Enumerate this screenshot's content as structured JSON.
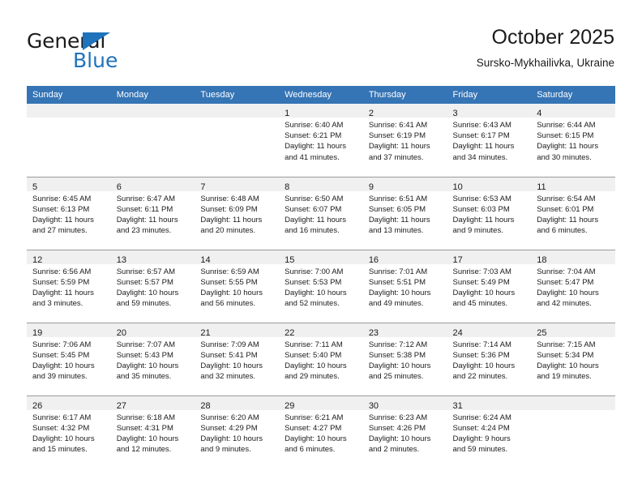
{
  "brand": {
    "name_top": "General",
    "name_bottom": "Blue",
    "accent_color": "#1f72bc",
    "triangle_icon": "triangle-icon"
  },
  "header": {
    "title": "October 2025",
    "subtitle": "Sursko-Mykhailivka, Ukraine"
  },
  "theme": {
    "header_row_bg": "#3574b5",
    "daynum_band_bg": "#f0f0f0",
    "grid_line": "#9a9a9a",
    "text": "#1b1b1b"
  },
  "weekday_headers": [
    "Sunday",
    "Monday",
    "Tuesday",
    "Wednesday",
    "Thursday",
    "Friday",
    "Saturday"
  ],
  "weeks": [
    [
      {
        "day": "",
        "lines": []
      },
      {
        "day": "",
        "lines": []
      },
      {
        "day": "",
        "lines": []
      },
      {
        "day": "1",
        "lines": [
          "Sunrise: 6:40 AM",
          "Sunset: 6:21 PM",
          "Daylight: 11 hours",
          "and 41 minutes."
        ]
      },
      {
        "day": "2",
        "lines": [
          "Sunrise: 6:41 AM",
          "Sunset: 6:19 PM",
          "Daylight: 11 hours",
          "and 37 minutes."
        ]
      },
      {
        "day": "3",
        "lines": [
          "Sunrise: 6:43 AM",
          "Sunset: 6:17 PM",
          "Daylight: 11 hours",
          "and 34 minutes."
        ]
      },
      {
        "day": "4",
        "lines": [
          "Sunrise: 6:44 AM",
          "Sunset: 6:15 PM",
          "Daylight: 11 hours",
          "and 30 minutes."
        ]
      }
    ],
    [
      {
        "day": "5",
        "lines": [
          "Sunrise: 6:45 AM",
          "Sunset: 6:13 PM",
          "Daylight: 11 hours",
          "and 27 minutes."
        ]
      },
      {
        "day": "6",
        "lines": [
          "Sunrise: 6:47 AM",
          "Sunset: 6:11 PM",
          "Daylight: 11 hours",
          "and 23 minutes."
        ]
      },
      {
        "day": "7",
        "lines": [
          "Sunrise: 6:48 AM",
          "Sunset: 6:09 PM",
          "Daylight: 11 hours",
          "and 20 minutes."
        ]
      },
      {
        "day": "8",
        "lines": [
          "Sunrise: 6:50 AM",
          "Sunset: 6:07 PM",
          "Daylight: 11 hours",
          "and 16 minutes."
        ]
      },
      {
        "day": "9",
        "lines": [
          "Sunrise: 6:51 AM",
          "Sunset: 6:05 PM",
          "Daylight: 11 hours",
          "and 13 minutes."
        ]
      },
      {
        "day": "10",
        "lines": [
          "Sunrise: 6:53 AM",
          "Sunset: 6:03 PM",
          "Daylight: 11 hours",
          "and 9 minutes."
        ]
      },
      {
        "day": "11",
        "lines": [
          "Sunrise: 6:54 AM",
          "Sunset: 6:01 PM",
          "Daylight: 11 hours",
          "and 6 minutes."
        ]
      }
    ],
    [
      {
        "day": "12",
        "lines": [
          "Sunrise: 6:56 AM",
          "Sunset: 5:59 PM",
          "Daylight: 11 hours",
          "and 3 minutes."
        ]
      },
      {
        "day": "13",
        "lines": [
          "Sunrise: 6:57 AM",
          "Sunset: 5:57 PM",
          "Daylight: 10 hours",
          "and 59 minutes."
        ]
      },
      {
        "day": "14",
        "lines": [
          "Sunrise: 6:59 AM",
          "Sunset: 5:55 PM",
          "Daylight: 10 hours",
          "and 56 minutes."
        ]
      },
      {
        "day": "15",
        "lines": [
          "Sunrise: 7:00 AM",
          "Sunset: 5:53 PM",
          "Daylight: 10 hours",
          "and 52 minutes."
        ]
      },
      {
        "day": "16",
        "lines": [
          "Sunrise: 7:01 AM",
          "Sunset: 5:51 PM",
          "Daylight: 10 hours",
          "and 49 minutes."
        ]
      },
      {
        "day": "17",
        "lines": [
          "Sunrise: 7:03 AM",
          "Sunset: 5:49 PM",
          "Daylight: 10 hours",
          "and 45 minutes."
        ]
      },
      {
        "day": "18",
        "lines": [
          "Sunrise: 7:04 AM",
          "Sunset: 5:47 PM",
          "Daylight: 10 hours",
          "and 42 minutes."
        ]
      }
    ],
    [
      {
        "day": "19",
        "lines": [
          "Sunrise: 7:06 AM",
          "Sunset: 5:45 PM",
          "Daylight: 10 hours",
          "and 39 minutes."
        ]
      },
      {
        "day": "20",
        "lines": [
          "Sunrise: 7:07 AM",
          "Sunset: 5:43 PM",
          "Daylight: 10 hours",
          "and 35 minutes."
        ]
      },
      {
        "day": "21",
        "lines": [
          "Sunrise: 7:09 AM",
          "Sunset: 5:41 PM",
          "Daylight: 10 hours",
          "and 32 minutes."
        ]
      },
      {
        "day": "22",
        "lines": [
          "Sunrise: 7:11 AM",
          "Sunset: 5:40 PM",
          "Daylight: 10 hours",
          "and 29 minutes."
        ]
      },
      {
        "day": "23",
        "lines": [
          "Sunrise: 7:12 AM",
          "Sunset: 5:38 PM",
          "Daylight: 10 hours",
          "and 25 minutes."
        ]
      },
      {
        "day": "24",
        "lines": [
          "Sunrise: 7:14 AM",
          "Sunset: 5:36 PM",
          "Daylight: 10 hours",
          "and 22 minutes."
        ]
      },
      {
        "day": "25",
        "lines": [
          "Sunrise: 7:15 AM",
          "Sunset: 5:34 PM",
          "Daylight: 10 hours",
          "and 19 minutes."
        ]
      }
    ],
    [
      {
        "day": "26",
        "lines": [
          "Sunrise: 6:17 AM",
          "Sunset: 4:32 PM",
          "Daylight: 10 hours",
          "and 15 minutes."
        ]
      },
      {
        "day": "27",
        "lines": [
          "Sunrise: 6:18 AM",
          "Sunset: 4:31 PM",
          "Daylight: 10 hours",
          "and 12 minutes."
        ]
      },
      {
        "day": "28",
        "lines": [
          "Sunrise: 6:20 AM",
          "Sunset: 4:29 PM",
          "Daylight: 10 hours",
          "and 9 minutes."
        ]
      },
      {
        "day": "29",
        "lines": [
          "Sunrise: 6:21 AM",
          "Sunset: 4:27 PM",
          "Daylight: 10 hours",
          "and 6 minutes."
        ]
      },
      {
        "day": "30",
        "lines": [
          "Sunrise: 6:23 AM",
          "Sunset: 4:26 PM",
          "Daylight: 10 hours",
          "and 2 minutes."
        ]
      },
      {
        "day": "31",
        "lines": [
          "Sunrise: 6:24 AM",
          "Sunset: 4:24 PM",
          "Daylight: 9 hours",
          "and 59 minutes."
        ]
      },
      {
        "day": "",
        "lines": []
      }
    ]
  ]
}
